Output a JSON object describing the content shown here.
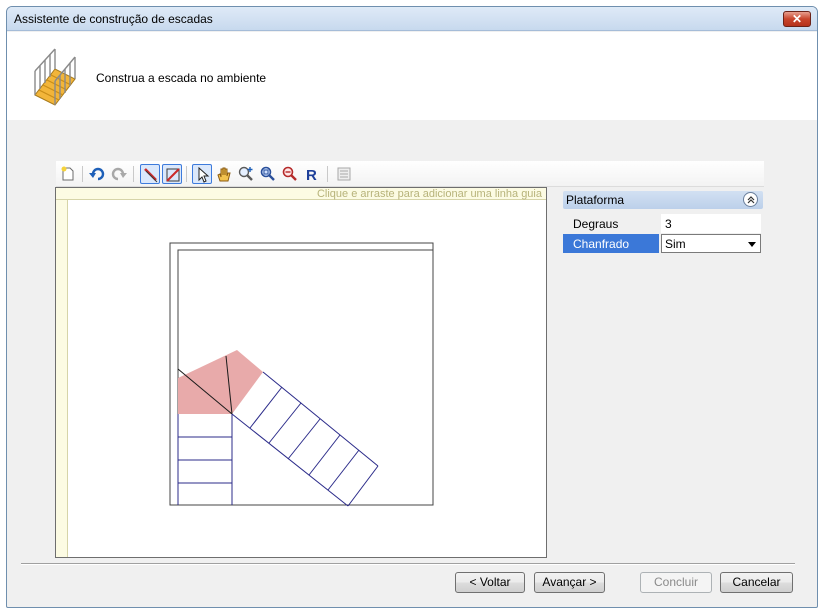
{
  "window": {
    "title": "Assistente de construção de escadas",
    "close_glyph": "✕"
  },
  "header": {
    "text": "Construa a escada no ambiente",
    "icon": "staircase-icon"
  },
  "toolbar": {
    "items": [
      "new-icon",
      "undo-icon",
      "redo-icon",
      "draw-wall-icon",
      "draw-stair-icon",
      "pointer-icon",
      "pan-hand-icon",
      "zoom-in-icon",
      "zoom-window-icon",
      "zoom-out-icon",
      "refresh-icon",
      "properties-icon"
    ]
  },
  "canvas": {
    "ruler_hint": "Clique e arraste para adicionar uma linha guia"
  },
  "properties": {
    "group": "Plataforma",
    "rows": [
      {
        "name": "Degraus",
        "value": "3"
      },
      {
        "name": "Chanfrado",
        "value": "Sim"
      }
    ]
  },
  "buttons": {
    "back": "< Voltar",
    "next": "Avançar >",
    "finish": "Concluir",
    "cancel": "Cancelar"
  },
  "colors": {
    "landing_fill": "#e8aaaa",
    "stair_line": "#2b2b8a"
  }
}
